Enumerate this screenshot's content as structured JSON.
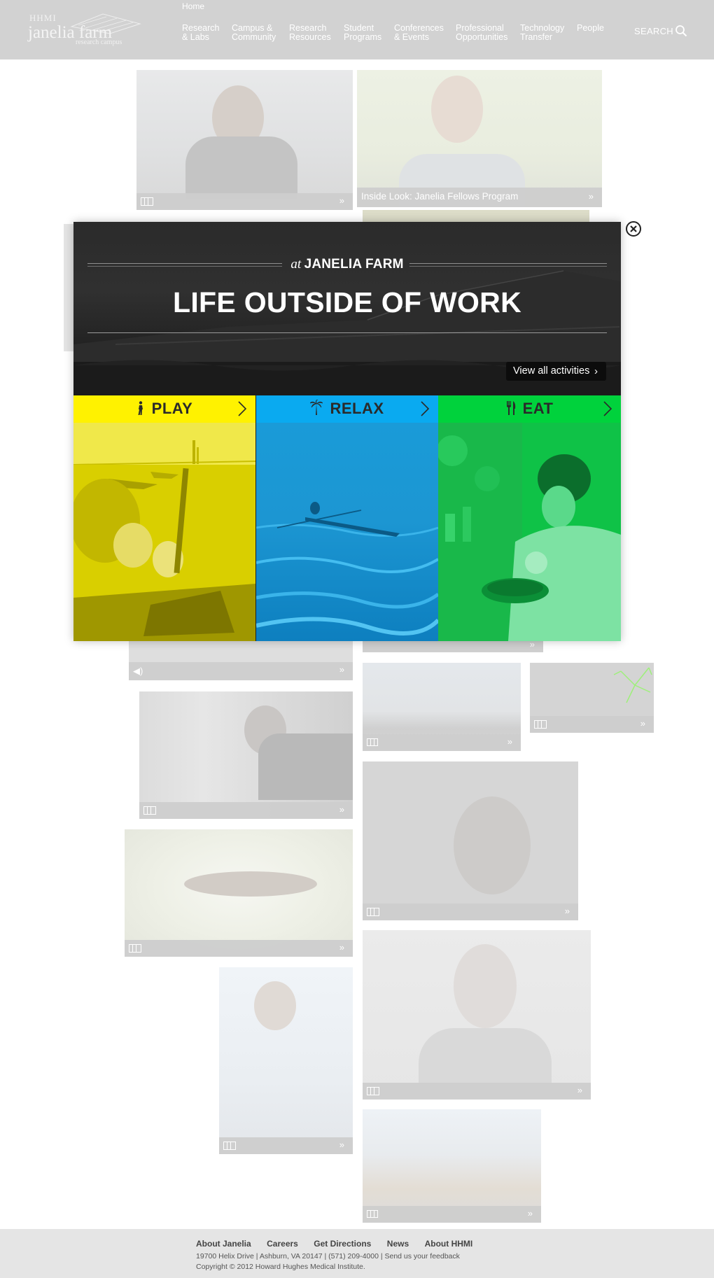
{
  "header": {
    "logo": {
      "org": "HHMI",
      "name": "janelia farm",
      "sub": "research campus"
    },
    "home": "Home",
    "nav": [
      {
        "label": "Research\n& Labs"
      },
      {
        "label": "Campus &\nCommunity"
      },
      {
        "label": "Research\nResources"
      },
      {
        "label": "Student\nPrograms"
      },
      {
        "label": "Conferences\n& Events"
      },
      {
        "label": "Professional\nOpportunities"
      },
      {
        "label": "Technology\nTransfer"
      },
      {
        "label": "People"
      }
    ],
    "search_label": "SEARCH"
  },
  "tiles": {
    "fellows_caption": "Inside Look: Janelia Fellows Program"
  },
  "modal": {
    "at": "at",
    "place": "JANELIA FARM",
    "title": "LIFE OUTSIDE OF WORK",
    "view_all": "View all activities",
    "columns": [
      {
        "label": "PLAY",
        "icon": "walking-person-icon",
        "color": "#fff200"
      },
      {
        "label": "RELAX",
        "icon": "palm-tree-icon",
        "color": "#0aaaf0"
      },
      {
        "label": "EAT",
        "icon": "fork-knife-icon",
        "color": "#00d23c"
      }
    ]
  },
  "footer": {
    "links": [
      "About Janelia",
      "Careers",
      "Get Directions",
      "News",
      "About HHMI"
    ],
    "address": "19700 Helix Drive | Ashburn, VA 20147 | (571) 209-4000 | Send us your feedback",
    "copyright": "Copyright © 2012 Howard Hughes Medical Institute."
  },
  "colors": {
    "header_bg": "#d2d2d2",
    "play": "#fff200",
    "relax": "#0aaaf0",
    "eat": "#00d23c"
  }
}
